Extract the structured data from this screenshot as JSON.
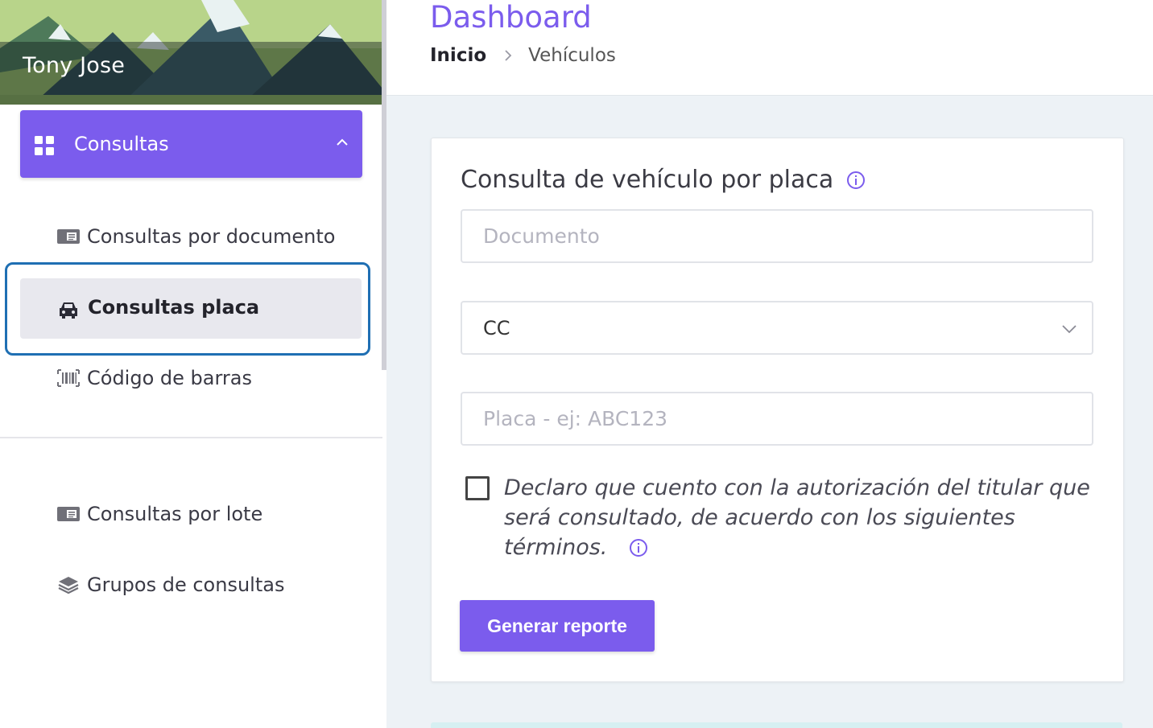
{
  "sidebar": {
    "user_name": "Tony Jose",
    "section_label": "Consultas",
    "items": [
      {
        "label": "Consultas por documento",
        "icon": "id-card-icon"
      },
      {
        "label": "Consultas placa",
        "icon": "car-icon",
        "active": true
      },
      {
        "label": "Código de barras",
        "icon": "barcode-icon"
      },
      {
        "label": "Consultas por lote",
        "icon": "id-card-icon"
      },
      {
        "label": "Grupos de consultas",
        "icon": "layers-icon"
      }
    ]
  },
  "header": {
    "title": "Dashboard",
    "breadcrumb": {
      "home": "Inicio",
      "current": "Vehículos"
    }
  },
  "form": {
    "title": "Consulta de vehículo por placa",
    "documento_placeholder": "Documento",
    "doc_type_value": "CC",
    "placa_placeholder": "Placa - ej: ABC123",
    "consent_text": "Declaro que cuento con la autorización del titular que será consultado, de acuerdo con los siguientes términos.",
    "submit_label": "Generar reporte"
  },
  "colors": {
    "accent": "#7b5ced",
    "active_outline": "#1f6fb3",
    "background": "#edf2f6"
  }
}
